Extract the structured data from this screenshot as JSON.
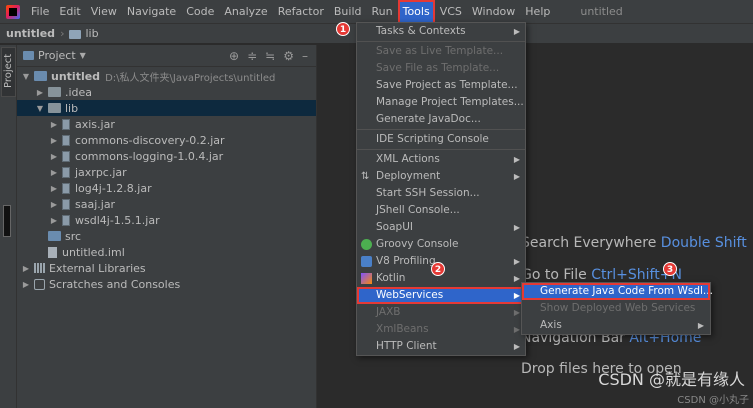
{
  "menubar": {
    "items": [
      "File",
      "Edit",
      "View",
      "Navigate",
      "Code",
      "Analyze",
      "Refactor",
      "Build",
      "Run",
      "Tools",
      "VCS",
      "Window",
      "Help"
    ],
    "title": "untitled"
  },
  "breadcrumb": {
    "project": "untitled",
    "folder": "lib"
  },
  "toolstrip": {
    "tab_label": "Project"
  },
  "project_panel": {
    "header": "Project",
    "root_name": "untitled",
    "root_path": "D:\\私人文件夹\\JavaProjects\\untitled",
    "idea": ".idea",
    "lib": "lib",
    "jars": [
      "axis.jar",
      "commons-discovery-0.2.jar",
      "commons-logging-1.0.4.jar",
      "jaxrpc.jar",
      "log4j-1.2.8.jar",
      "saaj.jar",
      "wsdl4j-1.5.1.jar"
    ],
    "src": "src",
    "iml": "untitled.iml",
    "external": "External Libraries",
    "scratches": "Scratches and Consoles"
  },
  "editor": {
    "search_label": "Search Everywhere",
    "search_key": "Double Shift",
    "goto_label": "Go to File",
    "goto_key": "Ctrl+Shift+N",
    "nav_label": "Navigation Bar",
    "nav_key": "Alt+Home",
    "drop_label": "Drop files here to open",
    "watermark": "CSDN @就是有缘人",
    "watermark_small": "CSDN @小丸子"
  },
  "tools_menu": {
    "tasks": "Tasks & Contexts",
    "save_live": "Save as Live Template...",
    "save_file": "Save File as Template...",
    "save_project": "Save Project as Template...",
    "manage": "Manage Project Templates...",
    "javadoc": "Generate JavaDoc...",
    "ide_scripting": "IDE Scripting Console",
    "xml_actions": "XML Actions",
    "deployment": "Deployment",
    "ssh": "Start SSH Session...",
    "jshell": "JShell Console...",
    "soapui": "SoapUI",
    "groovy": "Groovy Console",
    "v8": "V8 Profiling",
    "kotlin": "Kotlin",
    "webservices": "WebServices",
    "jaxb": "JAXB",
    "xmlbeans": "XmlBeans",
    "http": "HTTP Client"
  },
  "ws_submenu": {
    "generate": "Generate Java Code From Wsdl...",
    "show": "Show Deployed Web Services",
    "axis": "Axis"
  },
  "badges": [
    "1",
    "2",
    "3"
  ],
  "colors": {
    "accent": "#2f65ca",
    "highlight_border": "#e53935",
    "key_link": "#5890e0"
  }
}
